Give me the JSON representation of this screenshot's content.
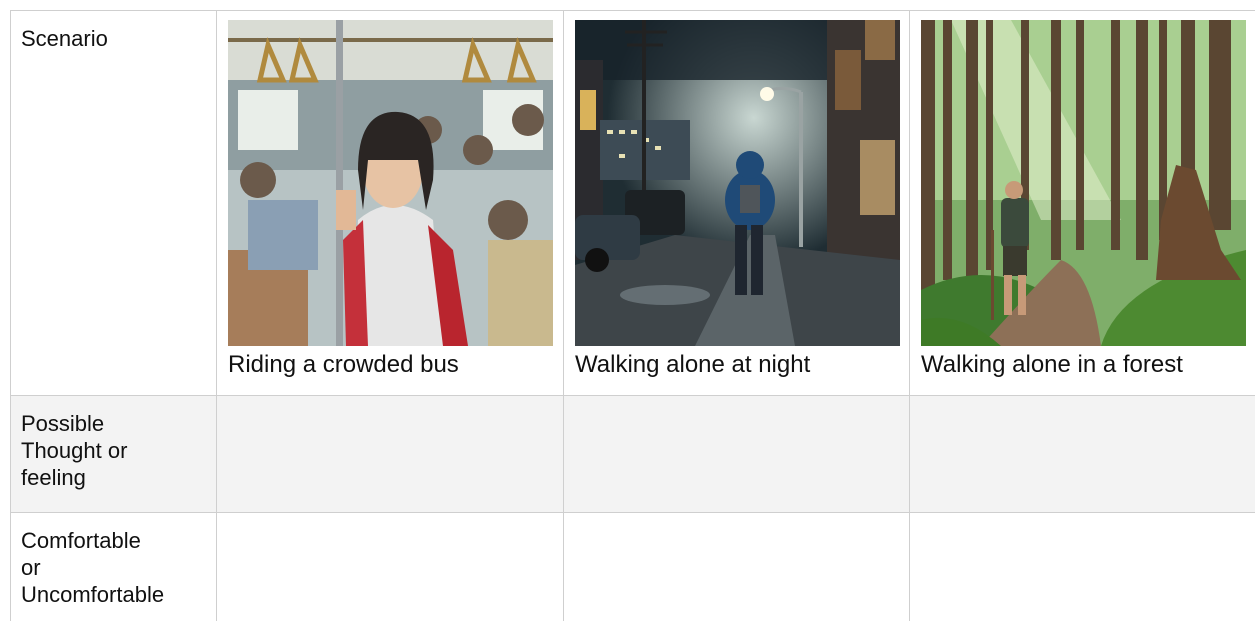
{
  "rows": [
    {
      "label": "Scenario"
    },
    {
      "label_lines": [
        "Possible",
        "Thought or",
        "feeling"
      ]
    },
    {
      "label_lines": [
        "Comfortable",
        "or",
        "Uncomfortable"
      ]
    }
  ],
  "scenarios": [
    {
      "caption": "Riding a crowded bus",
      "image": "crowded-bus-illustration"
    },
    {
      "caption": "Walking alone at night",
      "image": "night-street-illustration"
    },
    {
      "caption": "Walking alone in a forest",
      "image": "forest-path-illustration"
    }
  ],
  "colors": {
    "grid": "#cfcfcf",
    "shaded_row": "#f3f3f3"
  }
}
